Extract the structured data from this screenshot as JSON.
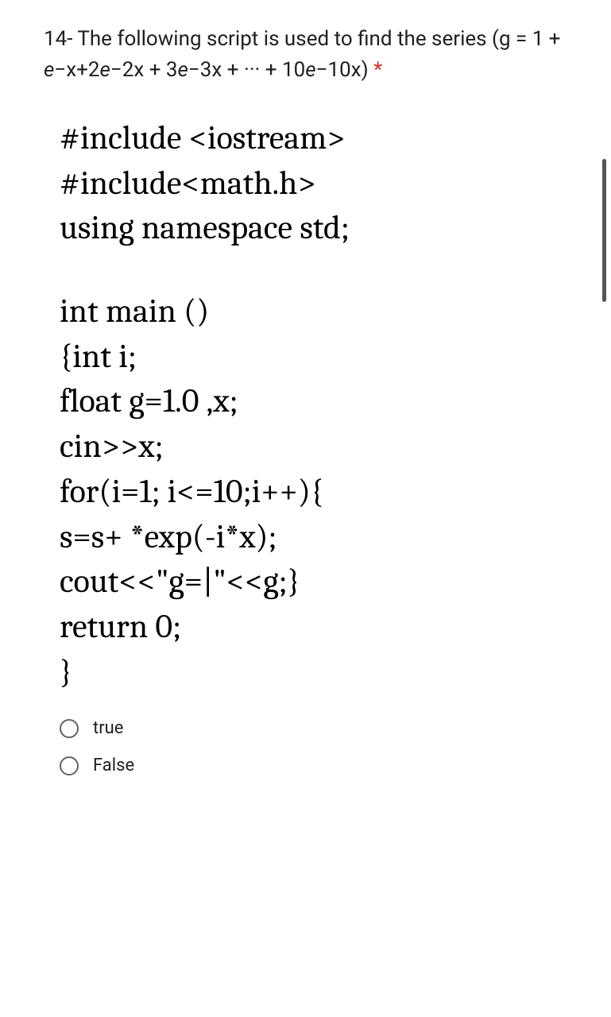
{
  "question": {
    "prefix": "14- The following script is used to find the series (g = 1 + ",
    "formula_part1": "e",
    "formula_part2": "−x",
    "formula_part3": "+2",
    "formula_part4": "e",
    "formula_part5": "−2x",
    "formula_part6": " + 3",
    "formula_part7": "e",
    "formula_part8": "−3x",
    "formula_part9": " + ··· + 10",
    "formula_part10": "e",
    "formula_part11": "−10x",
    "formula_part12": ")",
    "asterisk": " *"
  },
  "code": {
    "line1": "#include <iostream>",
    "line2": "#include<math.h>",
    "line3": "using namespace std;",
    "line4": "int main ()",
    "line5": "{int i;",
    "line6": "float g=1.0 ,x;",
    "line7": "cin>>x;",
    "line8": "for(i=1; i<=10;i++){",
    "line9": "s=s+ *exp(-i*x);",
    "line10": "cout<<\"g=|\"<<g;}",
    "line11": "return 0;",
    "line12": "}"
  },
  "options": {
    "opt1": "true",
    "opt2": "False"
  }
}
